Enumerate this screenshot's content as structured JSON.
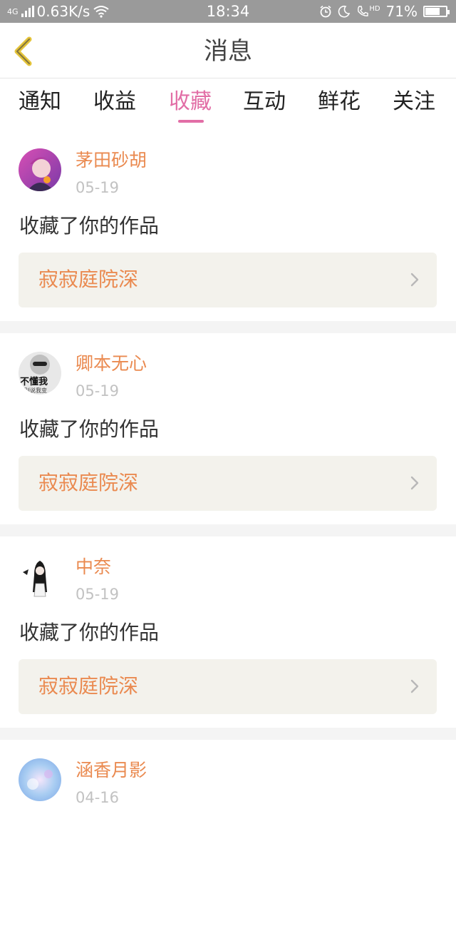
{
  "status_bar": {
    "network": "4G",
    "speed": "0.63K/s",
    "time": "18:34",
    "hd": "HD",
    "battery": "71%",
    "battery_level": 0.71
  },
  "nav": {
    "title": "消息",
    "back_icon": "chevron-left-icon",
    "accent_color": "#e5c43a"
  },
  "tabs": {
    "items": [
      {
        "label": "通知"
      },
      {
        "label": "收益"
      },
      {
        "label": "收藏"
      },
      {
        "label": "互动"
      },
      {
        "label": "鲜花"
      },
      {
        "label": "关注"
      }
    ],
    "active_index": 2,
    "active_color": "#e26ea6"
  },
  "feed": {
    "items": [
      {
        "user": "茅田砂胡",
        "date": "05-19",
        "action": "收藏了你的作品",
        "work_title": "寂寂庭院深"
      },
      {
        "user": "卿本无心",
        "date": "05-19",
        "action": "收藏了你的作品",
        "work_title": "寂寂庭院深",
        "avatar_text": [
          "不懂我",
          "别说我变"
        ]
      },
      {
        "user": "中奈",
        "date": "05-19",
        "action": "收藏了你的作品",
        "work_title": "寂寂庭院深"
      },
      {
        "user": "涵香月影",
        "date": "04-16"
      }
    ],
    "name_color": "#ea8a50"
  }
}
